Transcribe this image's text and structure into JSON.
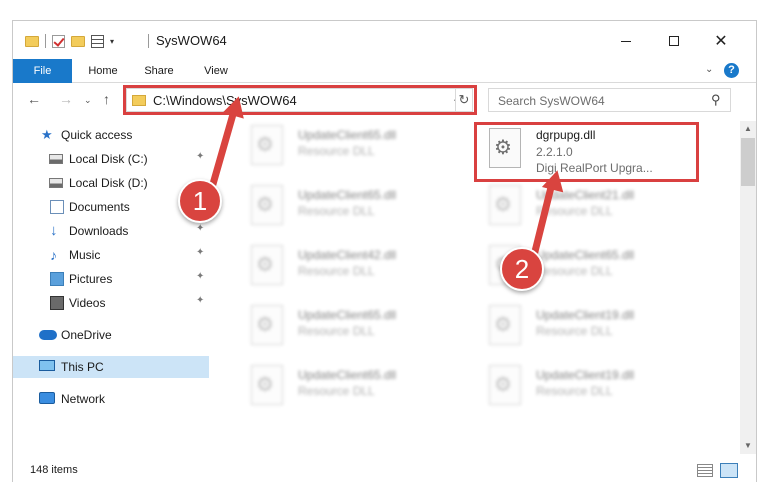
{
  "window": {
    "title": "SysWOW64",
    "quick_access_toolbar_caret": "▾",
    "minimize": "─",
    "maximize": "☐",
    "close": "✕"
  },
  "ribbon": {
    "tabs": [
      "File",
      "Home",
      "Share",
      "View"
    ],
    "expand_glyph": "⌄",
    "help_glyph": "?"
  },
  "address_bar": {
    "path": "C:\\Windows\\SysWOW64",
    "dropdown_glyph": "⌄",
    "refresh_glyph": "↻",
    "back_glyph": "←",
    "forward_glyph": "→",
    "recent_glyph": "⌄",
    "up_glyph": "↑"
  },
  "search": {
    "placeholder": "Search SysWOW64",
    "icon_glyph": "⚲"
  },
  "sidebar": {
    "items": [
      {
        "label": "Quick access",
        "icon": "star-icon",
        "pinned": false,
        "selected": false
      },
      {
        "label": "Local Disk (C:)",
        "icon": "disk-icon",
        "pinned": true,
        "selected": false
      },
      {
        "label": "Local Disk (D:)",
        "icon": "disk-icon",
        "pinned": false,
        "selected": false
      },
      {
        "label": "Documents",
        "icon": "documents-icon",
        "pinned": false,
        "selected": false
      },
      {
        "label": "Downloads",
        "icon": "downloads-icon",
        "pinned": true,
        "selected": false
      },
      {
        "label": "Music",
        "icon": "music-icon",
        "pinned": true,
        "selected": false
      },
      {
        "label": "Pictures",
        "icon": "pictures-icon",
        "pinned": true,
        "selected": false
      },
      {
        "label": "Videos",
        "icon": "videos-icon",
        "pinned": true,
        "selected": false
      },
      {
        "label": "OneDrive",
        "icon": "onedrive-icon",
        "pinned": false,
        "selected": false
      },
      {
        "label": "This PC",
        "icon": "this-pc-icon",
        "pinned": false,
        "selected": true
      },
      {
        "label": "Network",
        "icon": "network-icon",
        "pinned": false,
        "selected": false
      }
    ],
    "pin_glyph": "📌"
  },
  "files": {
    "selected": {
      "name": "dgrpupg.dll",
      "version": "2.2.1.0",
      "description": "Digi RealPort Upgra..."
    },
    "column_left": [
      {
        "name": "UpdateClient65.dll",
        "type": "Resource DLL"
      },
      {
        "name": "UpdateClient65.dll",
        "type": "Resource DLL"
      },
      {
        "name": "UpdateClient42.dll",
        "type": "Resource DLL"
      },
      {
        "name": "UpdateClient65.dll",
        "type": "Resource DLL"
      },
      {
        "name": "UpdateClient65.dll",
        "type": "Resource DLL"
      }
    ],
    "column_right": [
      {
        "name": "UpdateClient21.dll",
        "type": "Resource DLL"
      },
      {
        "name": "UpdateClient65.dll",
        "type": "Resource DLL"
      },
      {
        "name": "UpdateClient19.dll",
        "type": "Resource DLL"
      },
      {
        "name": "UpdateClient19.dll",
        "type": "Resource DLL"
      }
    ],
    "gear_glyph": "⚙"
  },
  "scrollbar": {
    "up_glyph": "▲",
    "down_glyph": "▼"
  },
  "status": {
    "item_count": "148 items"
  },
  "callouts": [
    "1",
    "2"
  ],
  "colors": {
    "accent": "#1979ca",
    "callout_red": "#d9443f",
    "selection": "#cce4f7"
  }
}
